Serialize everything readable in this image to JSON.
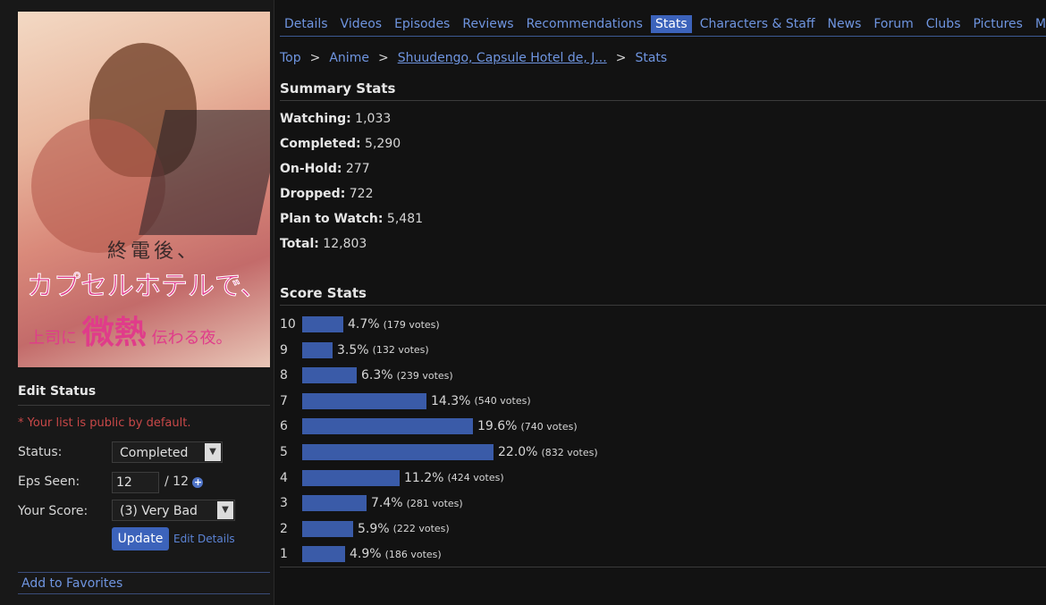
{
  "nav": {
    "tabs": [
      "Details",
      "Videos",
      "Episodes",
      "Reviews",
      "Recommendations",
      "Stats",
      "Characters & Staff",
      "News",
      "Forum",
      "Clubs",
      "Pictures",
      "More Info"
    ],
    "active": "Stats"
  },
  "breadcrumb": {
    "items": [
      "Top",
      "Anime",
      "Shuudengo, Capsule Hotel de, J...",
      "Stats"
    ],
    "separator": ">"
  },
  "cover": {
    "title_line1": "終電後、",
    "title_line2": "カプセルホテルで、",
    "title_line3a": "上司に",
    "title_line3b": "微熱",
    "title_line3c": "伝わる夜。"
  },
  "edit_status": {
    "heading": "Edit Status",
    "note": "* Your list is public by default.",
    "status_label": "Status:",
    "status_value": "Completed",
    "eps_label": "Eps Seen:",
    "eps_value": "12",
    "eps_total": "/ 12",
    "score_label": "Your Score:",
    "score_value": "(3) Very Bad",
    "update_button": "Update",
    "edit_details_link": "Edit Details",
    "favorites_link": "Add to Favorites"
  },
  "summary": {
    "heading": "Summary Stats",
    "items": [
      {
        "label": "Watching:",
        "value": "1,033"
      },
      {
        "label": "Completed:",
        "value": "5,290"
      },
      {
        "label": "On-Hold:",
        "value": "277"
      },
      {
        "label": "Dropped:",
        "value": "722"
      },
      {
        "label": "Plan to Watch:",
        "value": "5,481"
      },
      {
        "label": "Total:",
        "value": "12,803"
      }
    ]
  },
  "score_stats": {
    "heading": "Score Stats",
    "rows": [
      {
        "score": "10",
        "pct": "4.7%",
        "votes": "(179 votes)",
        "value": 4.7
      },
      {
        "score": "9",
        "pct": "3.5%",
        "votes": "(132 votes)",
        "value": 3.5
      },
      {
        "score": "8",
        "pct": "6.3%",
        "votes": "(239 votes)",
        "value": 6.3
      },
      {
        "score": "7",
        "pct": "14.3%",
        "votes": "(540 votes)",
        "value": 14.3
      },
      {
        "score": "6",
        "pct": "19.6%",
        "votes": "(740 votes)",
        "value": 19.6
      },
      {
        "score": "5",
        "pct": "22.0%",
        "votes": "(832 votes)",
        "value": 22.0
      },
      {
        "score": "4",
        "pct": "11.2%",
        "votes": "(424 votes)",
        "value": 11.2
      },
      {
        "score": "3",
        "pct": "7.4%",
        "votes": "(281 votes)",
        "value": 7.4
      },
      {
        "score": "2",
        "pct": "5.9%",
        "votes": "(222 votes)",
        "value": 5.9
      },
      {
        "score": "1",
        "pct": "4.9%",
        "votes": "(186 votes)",
        "value": 4.9
      }
    ]
  },
  "colors": {
    "accent": "#3c63bb",
    "link": "#6f95e0",
    "bar": "#3a5ba8",
    "note": "#c84848"
  }
}
